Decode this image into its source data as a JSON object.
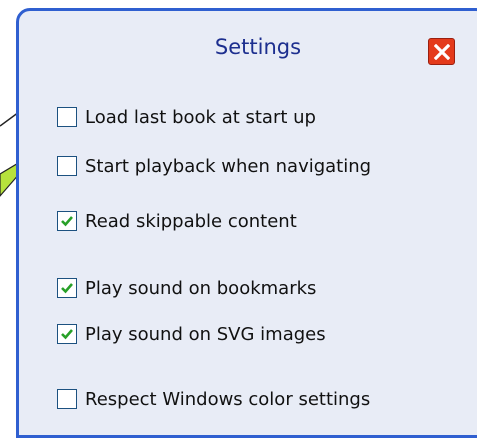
{
  "dialog": {
    "title": "Settings",
    "colors": {
      "accent": "#2f5fd0",
      "panel": "#e8ecf6",
      "close": "#e43a1b",
      "check": "#28a028"
    }
  },
  "options": [
    {
      "label": "Load last book at start up",
      "checked": false
    },
    {
      "label": "Start playback when navigating",
      "checked": false
    },
    {
      "label": "Read skippable content",
      "checked": true
    },
    {
      "label": "Play sound on bookmarks",
      "checked": true
    },
    {
      "label": "Play sound on SVG images",
      "checked": true
    },
    {
      "label": "Respect Windows color settings",
      "checked": false
    }
  ],
  "icons": {
    "close": "close-icon",
    "check": "checkmark-icon"
  }
}
